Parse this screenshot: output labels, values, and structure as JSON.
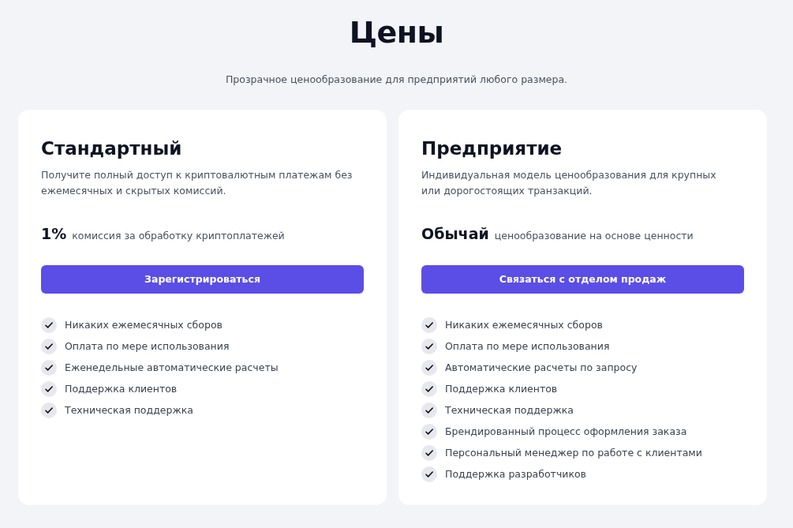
{
  "title": "Цены",
  "subtitle": "Прозрачное ценообразование для предприятий любого размера.",
  "plans": [
    {
      "name": "Стандартный",
      "description": "Получите полный доступ к криптовалютным платежам без ежемесячных и скрытых комиссий.",
      "price": "1%",
      "price_note": "комиссия за обработку криптоплатежей",
      "button": "Зарегистрироваться",
      "features": [
        "Никаких ежемесячных сборов",
        "Оплата по мере использования",
        "Еженедельные автоматические расчеты",
        "Поддержка клиентов",
        "Техническая поддержка"
      ]
    },
    {
      "name": "Предприятие",
      "description": "Индивидуальная модель ценообразования для крупных или дорогостоящих транзакций.",
      "price": "Обычай",
      "price_note": "ценообразование на основе ценности",
      "button": "Связаться с отделом продаж",
      "features": [
        "Никаких ежемесячных сборов",
        "Оплата по мере использования",
        "Автоматические расчеты по запросу",
        "Поддержка клиентов",
        "Техническая поддержка",
        "Брендированный процесс оформления заказа",
        "Персональный менеджер по работе с клиентами",
        "Поддержка разработчиков"
      ]
    }
  ]
}
